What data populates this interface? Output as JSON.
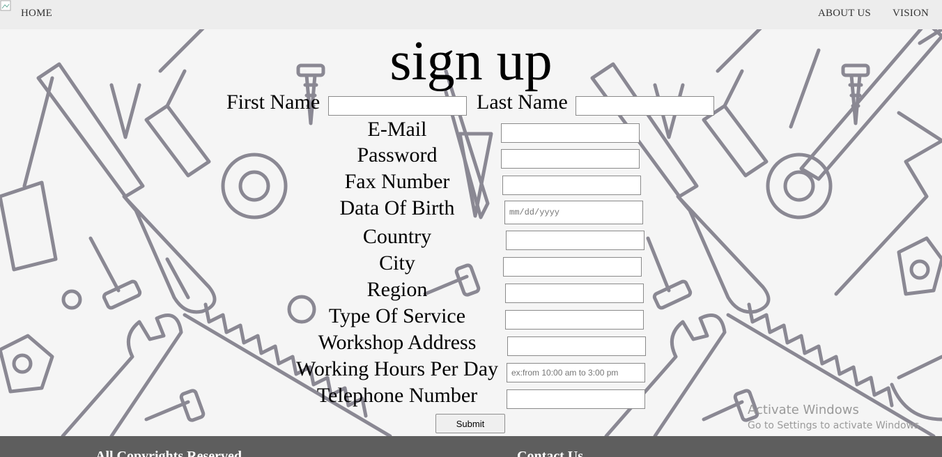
{
  "nav": {
    "home": "HOME",
    "about": "ABOUT US",
    "vision": "VISION"
  },
  "form": {
    "title": "sign up",
    "first_name": "First Name",
    "last_name": "Last Name",
    "email": "E-Mail",
    "password": "Password",
    "fax": "Fax Number",
    "dob": "Data Of Birth",
    "dob_placeholder": "mm/dd/yyyy",
    "country": "Country",
    "city": "City",
    "region": "Region",
    "service": "Type Of Service",
    "workshop": "Workshop Address",
    "hours": "Working Hours Per Day",
    "hours_placeholder": "ex:from 10:00 am to 3:00 pm",
    "phone": "Telephone Number",
    "submit": "Submit"
  },
  "watermark": {
    "line1": "Activate Windows",
    "line2": "Go to Settings to activate Windows."
  },
  "footer": {
    "rights": "All Copyrights Reserved",
    "contact": "Contact Us"
  }
}
